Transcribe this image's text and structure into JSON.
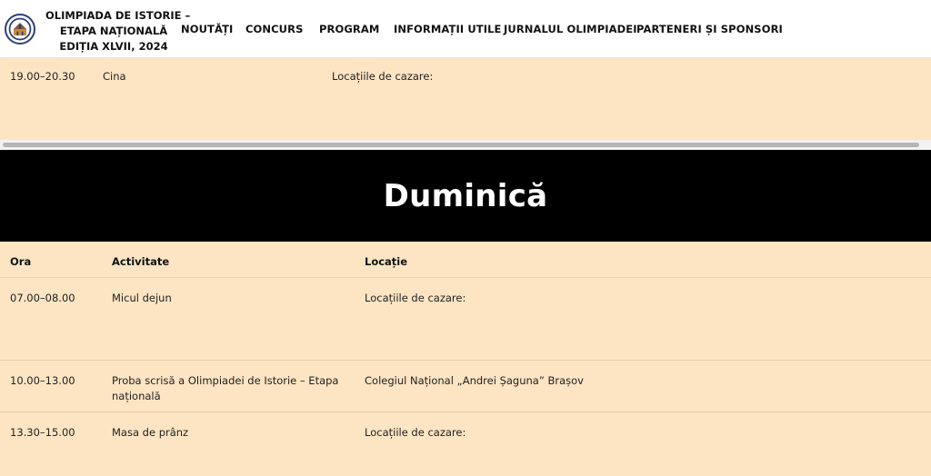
{
  "header": {
    "title_lines": [
      "OLIMPIADA DE ISTORIE –",
      "ETAPA NAȚIONALĂ",
      "EDIȚIA XLVII, 2024"
    ],
    "nav": [
      "NOUTĂȚI",
      "CONCURS",
      "PROGRAM",
      "INFORMAȚII UTILE",
      "JURNALUL OLIMPIADEI",
      "PARTENERI ȘI SPONSORI"
    ]
  },
  "prev_row": {
    "ora": "19.00–20.30",
    "activitate": "Cina",
    "locatie": "Locațiile de cazare:"
  },
  "day": {
    "title": "Duminică"
  },
  "table": {
    "headers": [
      "Ora",
      "Activitate",
      "Locație"
    ],
    "rows": [
      {
        "ora": "07.00–08.00",
        "activitate": "Micul dejun",
        "locatie": "Locațiile de cazare:"
      },
      {
        "ora": "10.00–13.00",
        "activitate": "Proba scrisă a Olimpiadei de Istorie – Etapa națională",
        "locatie": "Colegiul Național „Andrei Șaguna” Brașov"
      },
      {
        "ora": "13.30–15.00",
        "activitate": "Masa de prânz",
        "locatie": "Locațiile de cazare:"
      }
    ]
  },
  "colors": {
    "row_bg": "#fde5c3",
    "banner_bg": "#000000",
    "header_bg": "#ffffff",
    "logo_blue": "#2f3f79"
  },
  "icons": {
    "logo": "olympiad-logo"
  }
}
